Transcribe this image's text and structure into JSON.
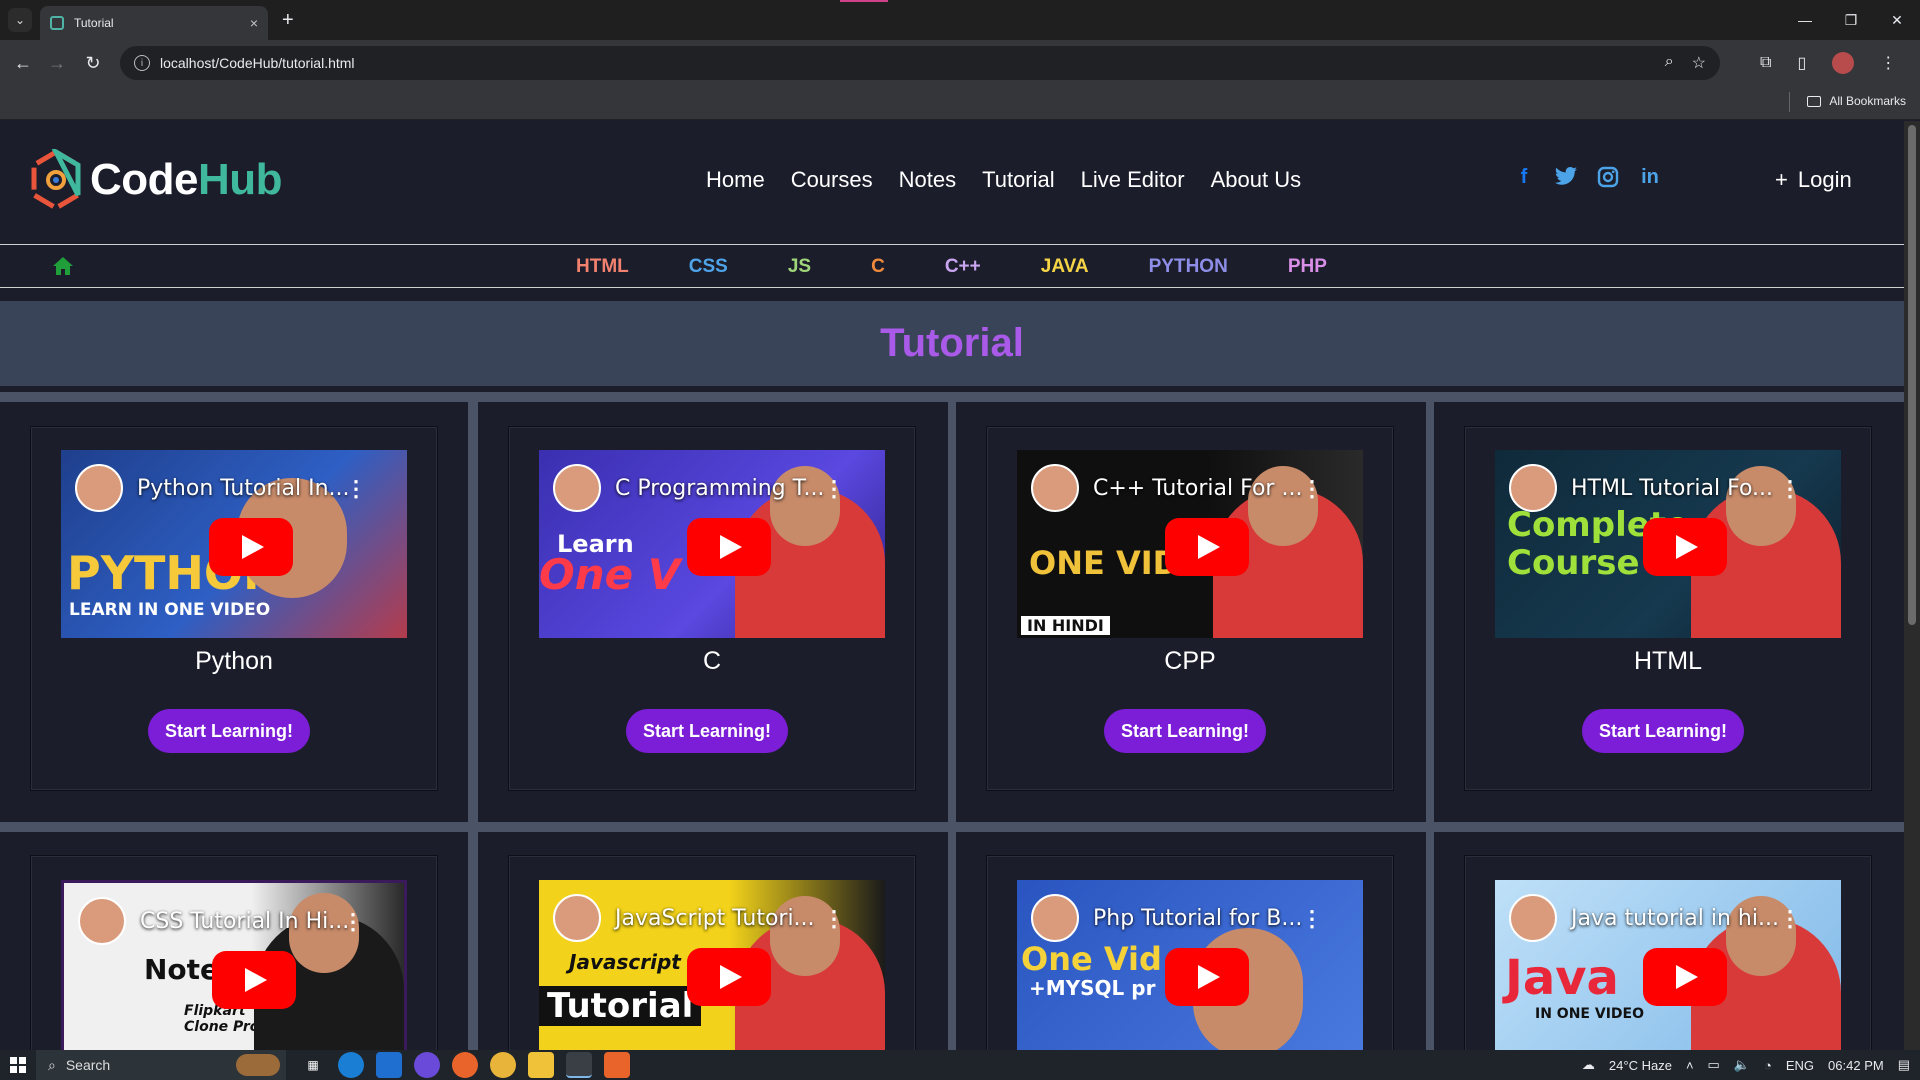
{
  "browser": {
    "tab_title": "Tutorial",
    "tab_close": "×",
    "new_tab": "+",
    "url": "localhost/CodeHub/tutorial.html",
    "bookmarks_label": "All Bookmarks"
  },
  "site": {
    "logo_code": "Code",
    "logo_hub": "Hub",
    "nav": [
      "Home",
      "Courses",
      "Notes",
      "Tutorial",
      "Live Editor",
      "About Us"
    ],
    "login": "Login",
    "login_plus": "+",
    "languages": [
      {
        "label": "HTML",
        "color": "#f2826f"
      },
      {
        "label": "CSS",
        "color": "#4fa3e8"
      },
      {
        "label": "JS",
        "color": "#9fd67a"
      },
      {
        "label": "C",
        "color": "#f08a3c"
      },
      {
        "label": "C++",
        "color": "#c9a5f0"
      },
      {
        "label": "JAVA",
        "color": "#f5d547"
      },
      {
        "label": "PYTHON",
        "color": "#8e8ee8"
      },
      {
        "label": "PHP",
        "color": "#d98fe8"
      }
    ],
    "page_title": "Tutorial"
  },
  "cards": [
    {
      "name": "Python",
      "video_title": "Python Tutorial In...",
      "thumb_text": "PYTHON",
      "thumb_sub": "LEARN IN ONE VIDEO",
      "thumb_bg": "#1f3f8c",
      "button": "Start Learning!"
    },
    {
      "name": "C",
      "video_title": "C Programming T...",
      "thumb_text": "One V",
      "thumb_sub": "Learn",
      "thumb_bg": "#3a2fb0",
      "button": "Start Learning!"
    },
    {
      "name": "CPP",
      "video_title": "C++ Tutorial For ...",
      "thumb_text": "ONE VID",
      "thumb_sub": "IN HINDI",
      "thumb_bg": "#111111",
      "button": "Start Learning!"
    },
    {
      "name": "HTML",
      "video_title": "HTML Tutorial Fo...",
      "thumb_text": "Complete Course",
      "thumb_sub": "",
      "thumb_bg": "#0f2a3a",
      "button": "Start Learning!"
    },
    {
      "name": "",
      "video_title": "CSS Tutorial In Hi...",
      "thumb_text": "Notes",
      "thumb_sub": "Flipkart Clone Project",
      "thumb_bg": "#eeeeee",
      "button": ""
    },
    {
      "name": "",
      "video_title": "JavaScript Tutori...",
      "thumb_text": "Tutorial",
      "thumb_sub": "Javascript",
      "thumb_bg": "#f2d21a",
      "button": ""
    },
    {
      "name": "",
      "video_title": "Php Tutorial for B...",
      "thumb_text": "One Vid",
      "thumb_sub": "+MYSQL pr",
      "thumb_bg": "#2a55c0",
      "button": ""
    },
    {
      "name": "",
      "video_title": "Java tutorial in hi...",
      "thumb_text": "Java",
      "thumb_sub": "IN ONE VIDEO",
      "thumb_bg": "#9fcdf0",
      "button": ""
    }
  ],
  "taskbar": {
    "search": "Search",
    "weather": "24°C  Haze",
    "lang": "ENG",
    "time": "06:42 PM"
  }
}
